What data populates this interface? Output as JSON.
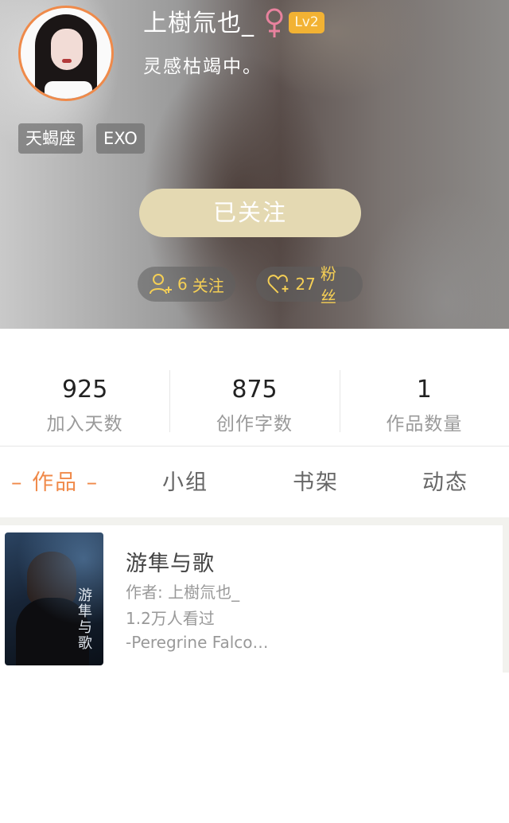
{
  "profile": {
    "username": "上樹氚也_",
    "gender_icon": "female-icon",
    "level": "Lv2",
    "bio": "灵感枯竭中。",
    "tags": [
      "天蝎座",
      "EXO"
    ],
    "follow_label": "已关注",
    "following_count": "6",
    "following_label": "关注",
    "fans_count": "27",
    "fans_label": "粉丝"
  },
  "stats": [
    {
      "value": "925",
      "label": "加入天数"
    },
    {
      "value": "875",
      "label": "创作字数"
    },
    {
      "value": "1",
      "label": "作品数量"
    }
  ],
  "tabs": {
    "works": "– 作品 –",
    "group": "小组",
    "bookshelf": "书架",
    "activity": "动态"
  },
  "works": [
    {
      "cover_title": "游隼与歌",
      "title": "游隼与歌",
      "author": "作者: 上樹氚也_",
      "views": "1.2万人看过",
      "description": "-Peregrine Falco…"
    }
  ],
  "colors": {
    "accent": "#f08a4a",
    "follow_button": "#e4d9b2",
    "level_badge": "#f2b233",
    "pill_text": "#f5cf55",
    "female": "#e8829e"
  }
}
